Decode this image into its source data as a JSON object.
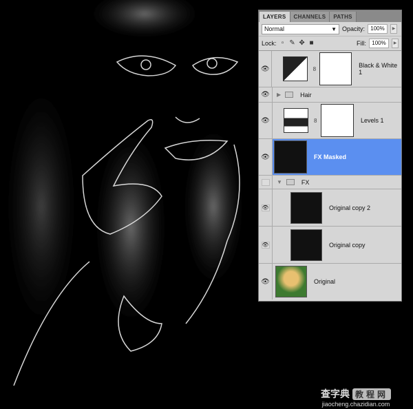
{
  "panel": {
    "tabs": [
      {
        "label": "LAYERS",
        "active": true
      },
      {
        "label": "CHANNELS",
        "active": false
      },
      {
        "label": "PATHS",
        "active": false
      }
    ],
    "blend_mode": "Normal",
    "opacity_label": "Opacity:",
    "opacity": "100%",
    "lock_label": "Lock:",
    "fill_label": "Fill:",
    "fill": "100%",
    "layers": [
      {
        "name": "Black & White 1",
        "type": "adjustment",
        "visible": true
      },
      {
        "name": "Hair",
        "type": "group",
        "collapsed": true,
        "visible": true
      },
      {
        "name": "Levels 1",
        "type": "adjustment",
        "visible": true
      },
      {
        "name": "FX Masked",
        "type": "pixel",
        "selected": true,
        "visible": true
      },
      {
        "name": "FX",
        "type": "group",
        "collapsed": false,
        "visible": false
      },
      {
        "name": "Original copy 2",
        "type": "smart-object",
        "visible": true
      },
      {
        "name": "Original copy",
        "type": "smart-object",
        "visible": true
      },
      {
        "name": "Original",
        "type": "pixel",
        "visible": true
      }
    ],
    "selected_color": "#5b8ff0"
  },
  "watermark": {
    "cn1": "查字典",
    "cn2": "教程网",
    "url": "jiaocheng.chazidian.com"
  }
}
